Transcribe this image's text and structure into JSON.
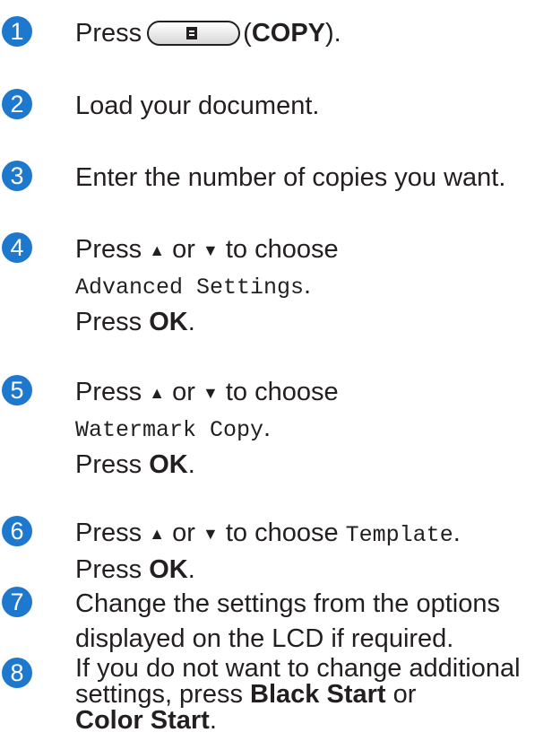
{
  "steps": [
    {
      "number": "1",
      "press": "Press",
      "copy_open": "(",
      "copy_label": "COPY",
      "copy_close": ")."
    },
    {
      "number": "2",
      "text": "Load your document."
    },
    {
      "number": "3",
      "text": "Enter the number of copies you want."
    },
    {
      "number": "4",
      "press_choose": "Press",
      "or": "or",
      "to_choose": "to choose",
      "option": "Advanced Settings",
      "period": ".",
      "press2": "Press",
      "ok": "OK",
      "ok_period": "."
    },
    {
      "number": "5",
      "press_choose": "Press",
      "or": "or",
      "to_choose": "to choose",
      "option": "Watermark Copy",
      "period": ".",
      "press2": "Press",
      "ok": "OK",
      "ok_period": "."
    },
    {
      "number": "6",
      "press_choose": "Press",
      "or": "or",
      "to_choose": "to choose",
      "option": "Template",
      "period": ".",
      "press2": "Press",
      "ok": "OK",
      "ok_period": "."
    },
    {
      "number": "7",
      "line1": "Change the settings from the options",
      "line2": "displayed on the LCD if required."
    },
    {
      "number": "8",
      "line1": "If you do not want to change additional",
      "line2_pre": "settings, press",
      "black_start": "Black Start",
      "or": "or",
      "color_start": "Color Start",
      "end": "."
    }
  ],
  "icons": {
    "up": "up-arrow-icon",
    "down": "down-arrow-icon",
    "copy": "copy-document-icon"
  },
  "colors": {
    "badge": "#1d78ce",
    "text": "#231f20"
  }
}
